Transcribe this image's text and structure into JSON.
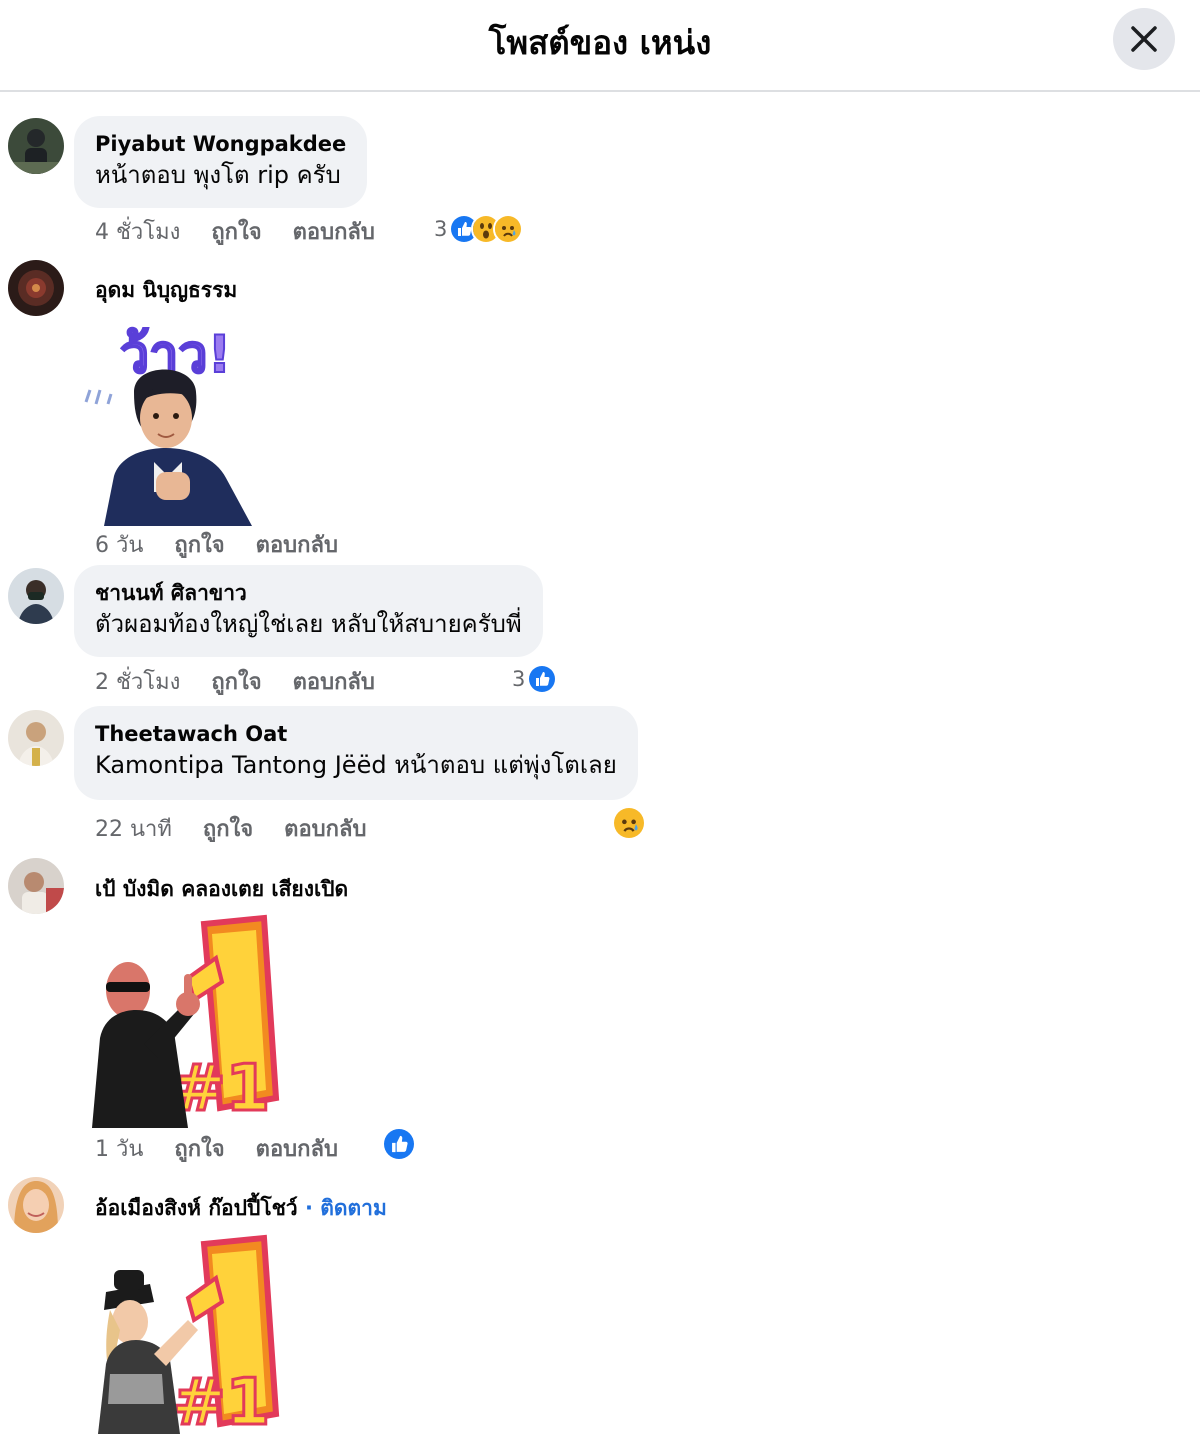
{
  "header": {
    "title": "โพสต์ของ เหน่ง",
    "close_icon": "close-icon"
  },
  "comments": [
    {
      "author": "Piyabut Wongpakdee",
      "text": "หน้าตอบ พุงโต rip ครับ",
      "time": "4 ชั่วโมง",
      "like_label": "ถูกใจ",
      "reply_label": "ตอบกลับ",
      "reaction_count": "3",
      "reactions": [
        "like-icon",
        "wow-icon",
        "sad-icon"
      ]
    },
    {
      "author": "อุดม นิบุญธรรม",
      "sticker": "wow-sticker",
      "sticker_text": "ว้าว!",
      "time": "6 วัน",
      "like_label": "ถูกใจ",
      "reply_label": "ตอบกลับ"
    },
    {
      "author": "ชานนท์ ศิลาขาว",
      "text": "ตัวผอมท้องใหญ่ใช่เลย หลับให้สบายครับพี่",
      "time": "2 ชั่วโมง",
      "like_label": "ถูกใจ",
      "reply_label": "ตอบกลับ",
      "reaction_count": "3",
      "reactions": [
        "like-icon"
      ]
    },
    {
      "author": "Theetawach Oat",
      "text": "Kamontipa Tantong Jëëd หน้าตอบ แต่พุ่งโตเลย",
      "time": "22 นาที",
      "like_label": "ถูกใจ",
      "reply_label": "ตอบกลับ",
      "reactions": [
        "sad-icon"
      ]
    },
    {
      "author": "เป้ บังมิด คลองเตย เสียงเปิด",
      "sticker": "number-one-sticker",
      "sticker_text": "#1",
      "time": "1 วัน",
      "like_label": "ถูกใจ",
      "reply_label": "ตอบกลับ",
      "reactions": [
        "like-icon"
      ]
    },
    {
      "author": "อ้อเมืองสิงห์ ก๊อปปี้โชว์",
      "follow_label": "· ติดตาม",
      "sticker": "number-one-sticker",
      "sticker_text": "#1"
    }
  ],
  "colors": {
    "bubble": "#f0f2f5",
    "like": "#1877f2",
    "link": "#216fdb",
    "meta": "#65676b",
    "emoji": "#f7b928"
  }
}
